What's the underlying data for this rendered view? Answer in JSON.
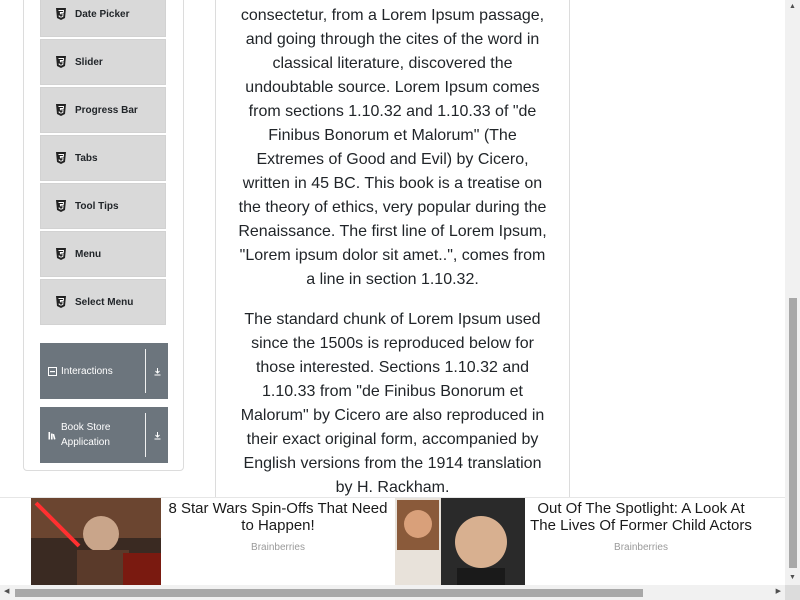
{
  "sidebar": {
    "items": [
      {
        "label": "Date Picker",
        "icon": "html5-icon"
      },
      {
        "label": "Slider",
        "icon": "html5-icon"
      },
      {
        "label": "Progress Bar",
        "icon": "html5-icon"
      },
      {
        "label": "Tabs",
        "icon": "html5-icon"
      },
      {
        "label": "Tool Tips",
        "icon": "html5-icon"
      },
      {
        "label": "Menu",
        "icon": "html5-icon"
      },
      {
        "label": "Select Menu",
        "icon": "html5-icon"
      }
    ],
    "groups": [
      {
        "label": "Interactions",
        "icon": "minus-square-icon"
      },
      {
        "label": "Book Store Application",
        "icon": "book-stack-icon"
      }
    ]
  },
  "content": {
    "paragraph_1": "consectetur, from a Lorem Ipsum passage, and going through the cites of the word in classical literature, discovered the undoubtable source. Lorem Ipsum comes from sections 1.10.32 and 1.10.33 of \"de Finibus Bonorum et Malorum\" (The Extremes of Good and Evil) by Cicero, written in 45 BC. This book is a treatise on the theory of ethics, very popular during the Renaissance. The first line of Lorem Ipsum, \"Lorem ipsum dolor sit amet..\", comes from a line in section 1.10.32.",
    "paragraph_2": "The standard chunk of Lorem Ipsum used since the 1500s is reproduced below for those interested. Sections 1.10.32 and 1.10.33 from \"de Finibus Bonorum et Malorum\" by Cicero are also reproduced in their exact original form, accompanied by English versions from the 1914 translation by H. Rackham."
  },
  "ads": [
    {
      "title": "8 Star Wars Spin-Offs That Need to Happen!",
      "source": "Brainberries"
    },
    {
      "title": "Out Of The Spotlight: A Look At The Lives Of Former Child Actors",
      "source": "Brainberries"
    }
  ],
  "colors": {
    "menu_item_bg": "#d9d9d9",
    "group_header_bg": "#6c757d",
    "ad_source": "#9a9a9a"
  }
}
